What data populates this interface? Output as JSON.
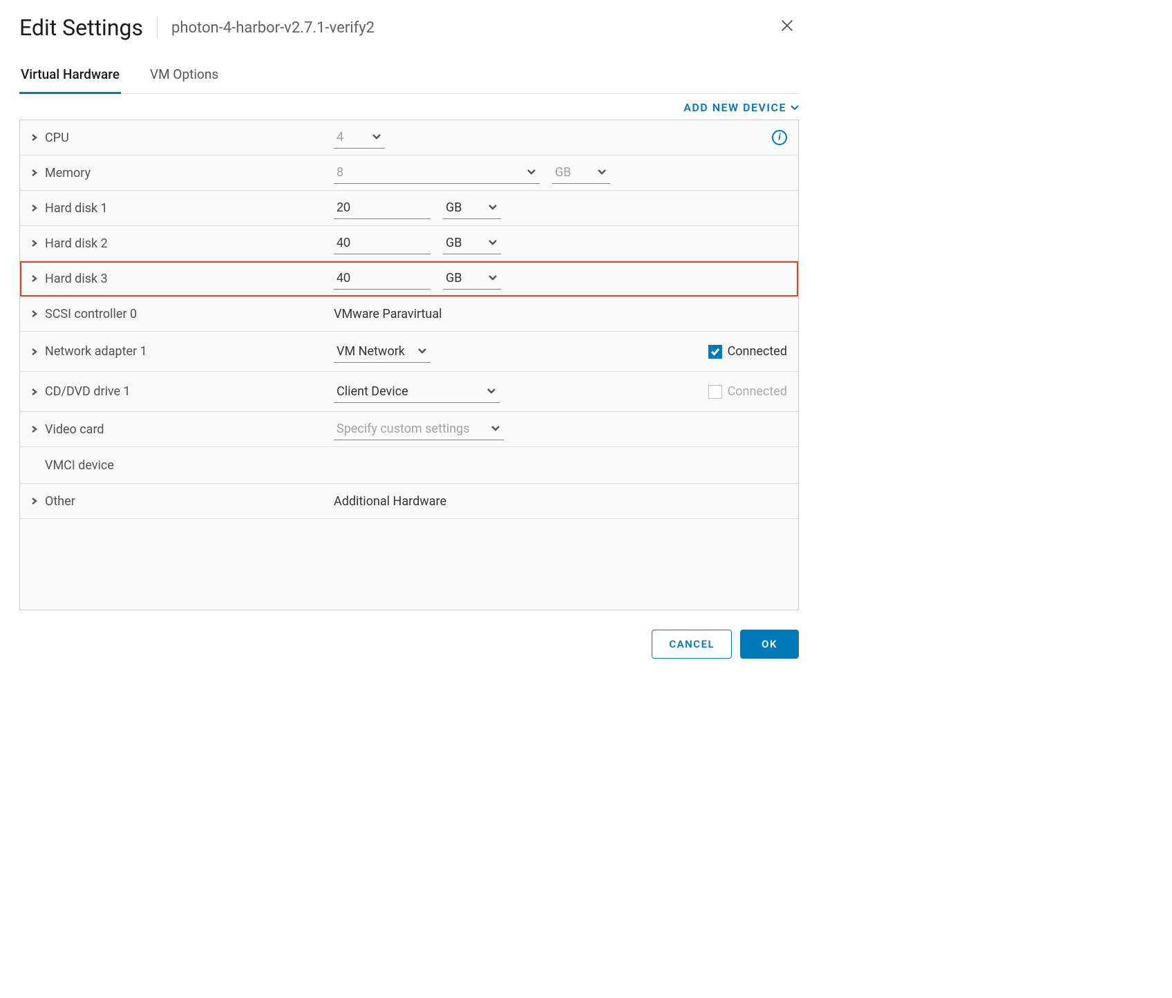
{
  "header": {
    "title": "Edit Settings",
    "subtitle": "photon-4-harbor-v2.7.1-verify2"
  },
  "tabs": {
    "hardware": "Virtual Hardware",
    "options": "VM Options"
  },
  "toolbar": {
    "add_device": "ADD NEW DEVICE"
  },
  "rows": {
    "cpu": {
      "label": "CPU",
      "value": "4"
    },
    "memory": {
      "label": "Memory",
      "value": "8",
      "unit": "GB"
    },
    "hd1": {
      "label": "Hard disk 1",
      "value": "20",
      "unit": "GB"
    },
    "hd2": {
      "label": "Hard disk 2",
      "value": "40",
      "unit": "GB"
    },
    "hd3": {
      "label": "Hard disk 3",
      "value": "40",
      "unit": "GB"
    },
    "scsi": {
      "label": "SCSI controller 0",
      "value": "VMware Paravirtual"
    },
    "net": {
      "label": "Network adapter 1",
      "value": "VM Network",
      "connected": "Connected"
    },
    "cd": {
      "label": "CD/DVD drive 1",
      "value": "Client Device",
      "connected": "Connected"
    },
    "video": {
      "label": "Video card",
      "value": "Specify custom settings"
    },
    "vmci": {
      "label": "VMCI device"
    },
    "other": {
      "label": "Other",
      "value": "Additional Hardware"
    }
  },
  "footer": {
    "cancel": "CANCEL",
    "ok": "OK"
  }
}
